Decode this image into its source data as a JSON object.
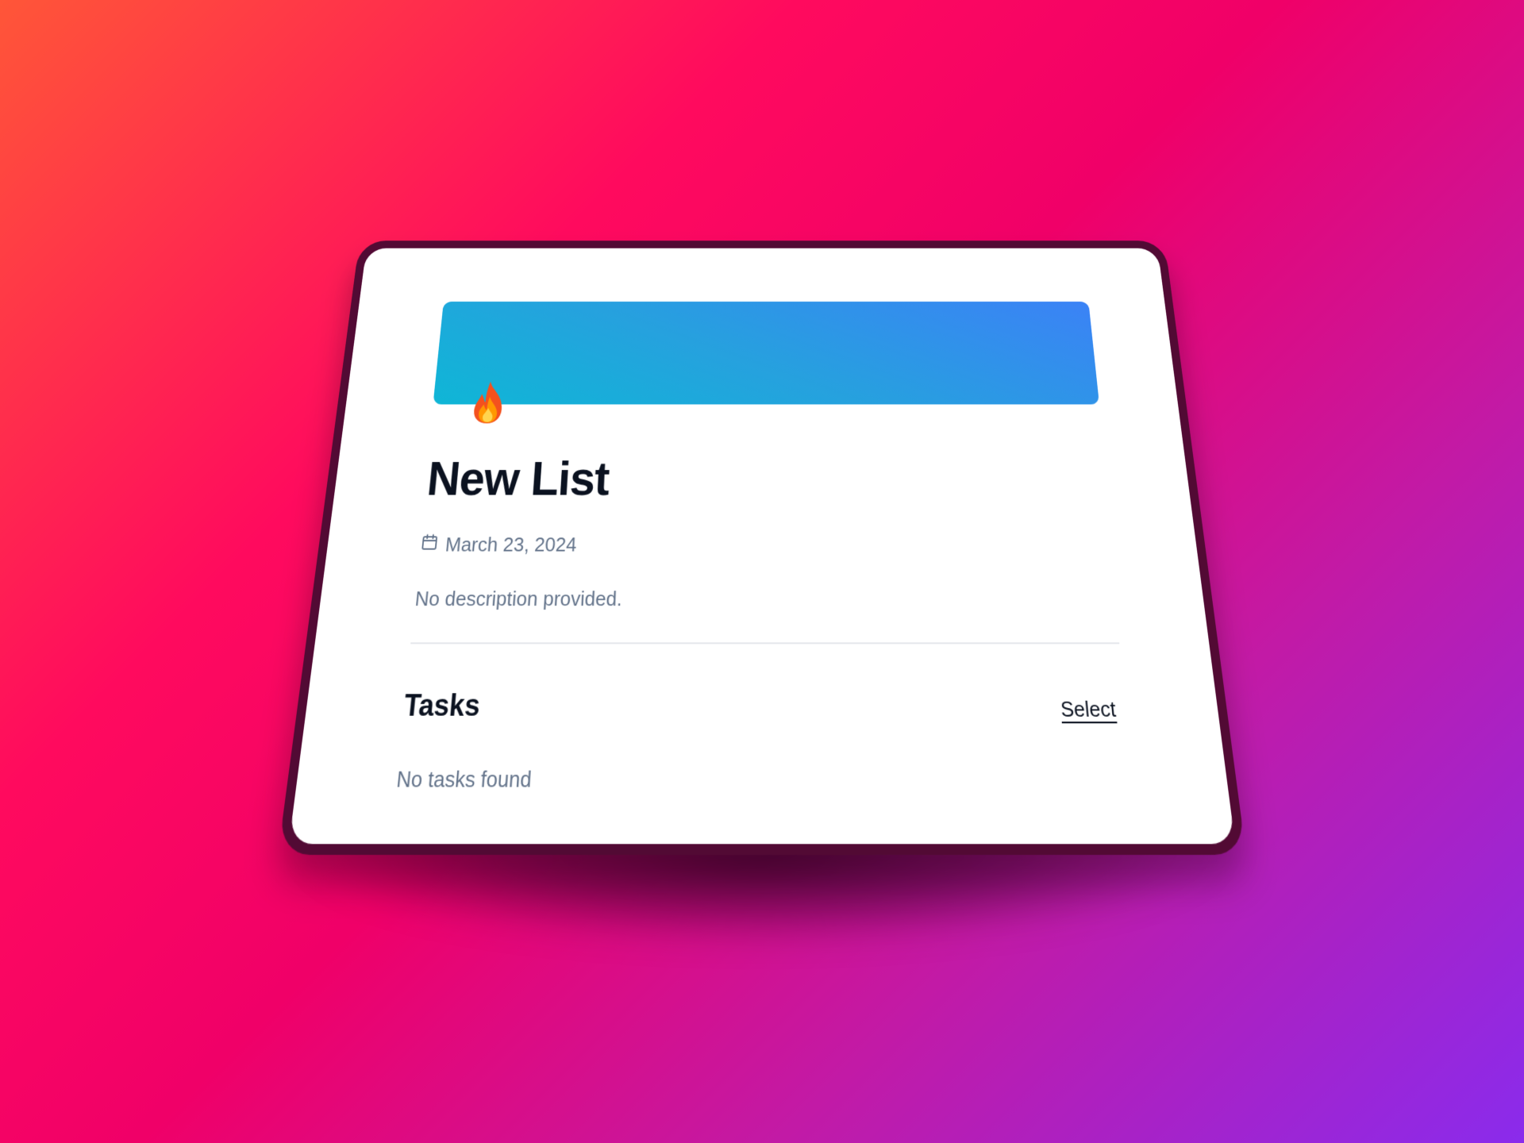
{
  "list": {
    "title": "New List",
    "icon": "fire-emoji",
    "date": "March 23, 2024",
    "description": "No description provided."
  },
  "tasks": {
    "heading": "Tasks",
    "select_label": "Select",
    "empty_message": "No tasks found"
  },
  "colors": {
    "banner_start": "#0fb6d6",
    "banner_end": "#3b82f6",
    "background_start": "#ff5638",
    "background_mid": "#ff0a5e",
    "background_end": "#8a2bec"
  }
}
